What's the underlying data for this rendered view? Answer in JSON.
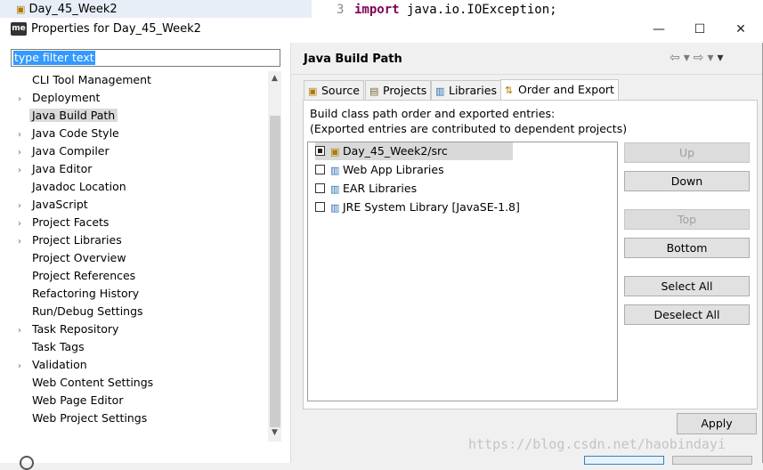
{
  "background": {
    "project_label": "Day_45_Week2",
    "line_number": "3",
    "code_keyword": "import",
    "code_rest": " java.io.IOException;"
  },
  "window": {
    "app_icon_text": "me",
    "title": "Properties for Day_45_Week2",
    "minimize": "—",
    "maximize": "☐",
    "close": "✕"
  },
  "sidebar": {
    "filter_text": "type filter text",
    "items": [
      {
        "label": "CLI Tool Management",
        "arrow": ""
      },
      {
        "label": "Deployment",
        "arrow": "›"
      },
      {
        "label": "Java Build Path",
        "arrow": ""
      },
      {
        "label": "Java Code Style",
        "arrow": "›"
      },
      {
        "label": "Java Compiler",
        "arrow": "›"
      },
      {
        "label": "Java Editor",
        "arrow": "›"
      },
      {
        "label": "Javadoc Location",
        "arrow": ""
      },
      {
        "label": "JavaScript",
        "arrow": "›"
      },
      {
        "label": "Project Facets",
        "arrow": "›"
      },
      {
        "label": "Project Libraries",
        "arrow": "›"
      },
      {
        "label": "Project Overview",
        "arrow": ""
      },
      {
        "label": "Project References",
        "arrow": ""
      },
      {
        "label": "Refactoring History",
        "arrow": ""
      },
      {
        "label": "Run/Debug Settings",
        "arrow": ""
      },
      {
        "label": "Task Repository",
        "arrow": "›"
      },
      {
        "label": "Task Tags",
        "arrow": ""
      },
      {
        "label": "Validation",
        "arrow": "›"
      },
      {
        "label": "Web Content Settings",
        "arrow": ""
      },
      {
        "label": "Web Page Editor",
        "arrow": ""
      },
      {
        "label": "Web Project Settings",
        "arrow": ""
      }
    ],
    "selected_index": 2
  },
  "main": {
    "heading": "Java Build Path",
    "tabs": [
      {
        "label": "Source"
      },
      {
        "label": "Projects"
      },
      {
        "label": "Libraries"
      },
      {
        "label": "Order and Export"
      }
    ],
    "active_tab": "Order and Export",
    "description_line1": "Build class path order and exported entries:",
    "description_line2": "(Exported entries are contributed to dependent projects)",
    "entries": [
      {
        "label": "Day_45_Week2/src",
        "checked": "partial",
        "icon": "source-folder-icon"
      },
      {
        "label": "Web App Libraries",
        "checked": "unchecked",
        "icon": "library-icon"
      },
      {
        "label": "EAR Libraries",
        "checked": "unchecked",
        "icon": "library-icon"
      },
      {
        "label": "JRE System Library [JavaSE-1.8]",
        "checked": "unchecked",
        "icon": "library-icon"
      }
    ],
    "buttons": {
      "up": "Up",
      "down": "Down",
      "top": "Top",
      "bottom": "Bottom",
      "select_all": "Select All",
      "deselect_all": "Deselect All"
    },
    "apply": "Apply"
  },
  "watermark": "https://blog.csdn.net/haobindayi"
}
